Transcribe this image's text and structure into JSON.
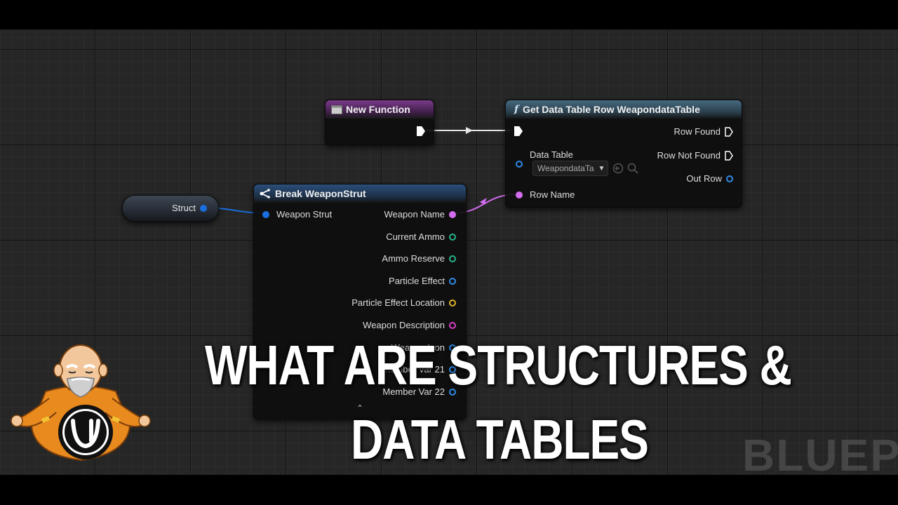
{
  "nodes": {
    "struct_var": {
      "label": "Struct"
    },
    "new_function": {
      "title": "New Function"
    },
    "get_row": {
      "title": "Get Data Table Row WeapondataTable",
      "func_glyph": "f",
      "outputs": {
        "row_found": "Row Found",
        "row_not_found": "Row Not Found",
        "out_row": "Out Row"
      },
      "inputs": {
        "data_table": "Data Table",
        "data_table_value": "WeapondataTa",
        "row_name": "Row Name"
      }
    },
    "break_struct": {
      "title": "Break WeaponStrut",
      "input": "Weapon Strut",
      "outputs": [
        {
          "label": "Weapon Name",
          "color": "#d46cf0"
        },
        {
          "label": "Current Ammo",
          "color": "#27b48a"
        },
        {
          "label": "Ammo Reserve",
          "color": "#27b48a"
        },
        {
          "label": "Particle Effect",
          "color": "#2f8ae8"
        },
        {
          "label": "Particle Effect Location",
          "color": "#e2b22a"
        },
        {
          "label": "Weapon Description",
          "color": "#d53fc7"
        },
        {
          "label": "Weapon Icon",
          "color": "#2f8ae8"
        },
        {
          "label": "Member Var 21",
          "color": "#2f8ae8"
        },
        {
          "label": "Member Var 22",
          "color": "#2f8ae8"
        }
      ]
    }
  },
  "overlay": {
    "line1": "WHAT ARE STRUCTURES &",
    "line2": "DATA TABLES"
  },
  "watermark": "BLUEPI",
  "colors": {
    "struct_pin": "#1a6fe0",
    "name_pin": "#d46cf0",
    "exec": "#ffffff",
    "object_pin": "#2f8ae8"
  },
  "icons": [
    "function-icon",
    "break-struct-icon",
    "zoom-icon",
    "browse-icon",
    "mascot-logo",
    "unreal-logo"
  ]
}
